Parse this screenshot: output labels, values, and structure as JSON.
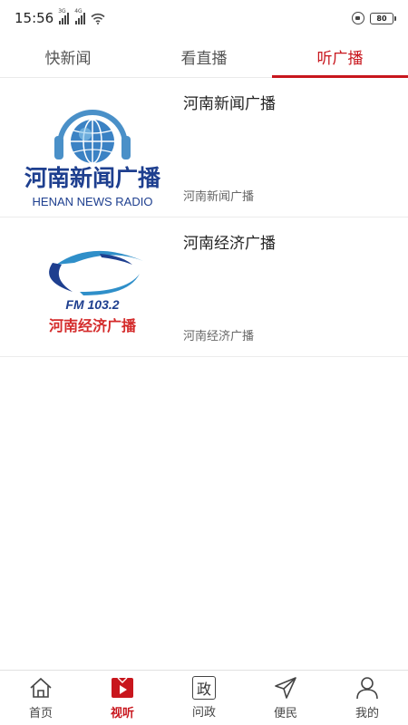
{
  "status_bar": {
    "time": "15:56",
    "net1": "3G",
    "net2": "4G",
    "battery": "80"
  },
  "top_tabs": [
    {
      "label": "快新闻",
      "active": false
    },
    {
      "label": "看直播",
      "active": false
    },
    {
      "label": "听广播",
      "active": true
    }
  ],
  "stations": [
    {
      "title": "河南新闻广播",
      "subtitle": "河南新闻广播",
      "logo": {
        "icon": "globe-headphones-icon",
        "cn_text": "河南新闻广播",
        "en_text": "HENAN NEWS RADIO",
        "colors": {
          "primary": "#1e3f8f",
          "globe": "#4a90c8"
        }
      }
    },
    {
      "title": "河南经济广播",
      "subtitle": "河南经济广播",
      "logo": {
        "icon": "orbit-swoosh-icon",
        "fm_text": "FM 103.2",
        "cn_text": "河南经济广播",
        "colors": {
          "primary": "#1e3f8f",
          "accent": "#d42a2a",
          "swoosh": "#2f8fc9"
        }
      }
    }
  ],
  "bottom_nav": [
    {
      "label": "首页",
      "icon": "home-icon",
      "active": false
    },
    {
      "label": "视听",
      "icon": "tv-play-icon",
      "active": true
    },
    {
      "label": "问政",
      "icon": "zheng-box-icon",
      "glyph": "政",
      "active": false
    },
    {
      "label": "便民",
      "icon": "paper-plane-icon",
      "active": false
    },
    {
      "label": "我的",
      "icon": "user-icon",
      "active": false
    }
  ],
  "colors": {
    "accent": "#c8161d",
    "text": "#222222",
    "muted": "#666666",
    "divider": "#ececec"
  }
}
